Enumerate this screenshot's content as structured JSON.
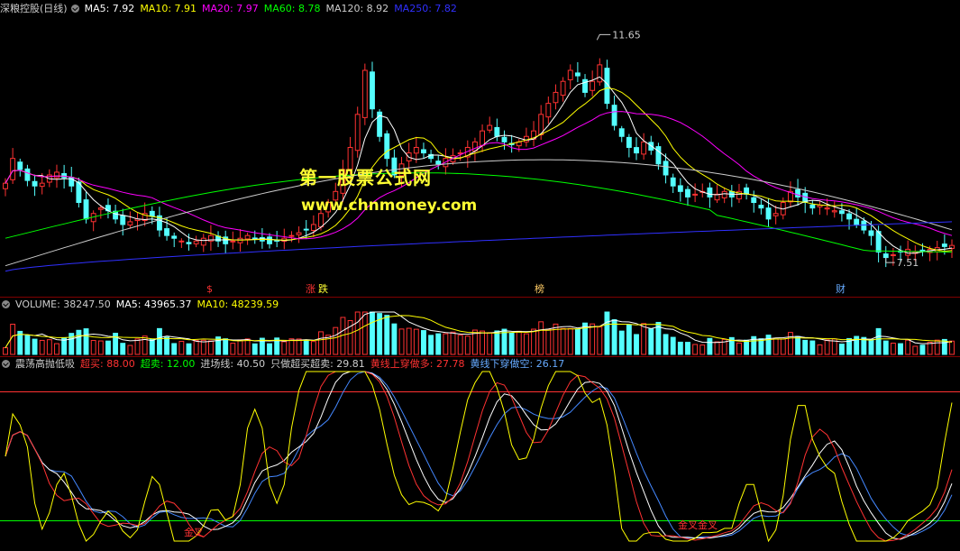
{
  "colors": {
    "up": "#ff3232",
    "down": "#54ffff",
    "ma5": "#ffffff",
    "ma10": "#ffff00",
    "ma20": "#ff00ff",
    "ma60": "#00ff00",
    "ma120": "#cccccc",
    "ma250": "#3030ff"
  },
  "main": {
    "title": "深粮控股(日线)",
    "ma5": "MA5: 7.92",
    "ma10": "MA10: 7.91",
    "ma20": "MA20: 7.97",
    "ma60": "MA60: 8.78",
    "ma120": "MA120: 8.92",
    "ma250": "MA250: 7.82",
    "high_label": "11.65",
    "low_label": "7.51",
    "watermark_cn": "第一股票公式网",
    "watermark_url": "www.chnmoney.com",
    "events": [
      {
        "text": "$",
        "color": "#ff3232"
      },
      {
        "text": "涨",
        "color": "#ff3232"
      },
      {
        "text": "跌",
        "color": "#ffff33"
      },
      {
        "text": "榜",
        "color": "#ffcc66"
      },
      {
        "text": "财",
        "color": "#66aaff"
      }
    ]
  },
  "volume": {
    "title": "VOLUME: 38247.50",
    "ma5": "MA5: 43965.37",
    "ma10": "MA10: 48239.59"
  },
  "indicator": {
    "title": "震荡高抛低吸",
    "p1": "超买: 88.00",
    "p2": "超卖: 12.00",
    "p3": "进场线: 40.50",
    "p4": "只做超买超卖: 29.81",
    "p5": "黄线上穿做多: 27.78",
    "p6": "黄线下穿做空: 26.17",
    "sig1": "金叉",
    "sig2": "金叉金叉"
  },
  "chart_data": {
    "type": "candlestick",
    "price_range": [
      7.51,
      11.65
    ],
    "close_series_approx": [
      8.95,
      9.4,
      9.2,
      9.0,
      8.9,
      8.95,
      9.1,
      9.15,
      9.05,
      8.9,
      8.6,
      8.3,
      8.4,
      8.5,
      8.45,
      8.3,
      8.2,
      8.25,
      8.3,
      8.4,
      8.35,
      8.1,
      8.0,
      7.95,
      7.9,
      7.85,
      7.9,
      7.95,
      8.0,
      7.9,
      7.85,
      7.9,
      7.95,
      8.0,
      7.95,
      7.9,
      7.85,
      7.9,
      7.95,
      8.0,
      8.05,
      8.1,
      8.2,
      8.4,
      8.6,
      8.8,
      9.2,
      9.6,
      10.2,
      11.0,
      10.3,
      9.8,
      9.4,
      9.1,
      9.3,
      9.5,
      9.6,
      9.5,
      9.4,
      9.3,
      9.4,
      9.45,
      9.5,
      9.6,
      9.7,
      9.9,
      10.0,
      9.8,
      9.7,
      9.65,
      9.7,
      9.8,
      9.9,
      10.2,
      10.4,
      10.6,
      10.8,
      11.0,
      10.9,
      10.6,
      10.8,
      11.1,
      10.4,
      10.0,
      9.8,
      9.6,
      9.5,
      9.7,
      9.55,
      9.3,
      9.1,
      8.9,
      8.8,
      8.7,
      8.75,
      8.8,
      8.7,
      8.75,
      8.8,
      8.7,
      8.8,
      8.75,
      8.6,
      8.5,
      8.3,
      8.4,
      8.6,
      8.8,
      8.7,
      8.6,
      8.5,
      8.55,
      8.5,
      8.45,
      8.4,
      8.3,
      8.2,
      8.1,
      8.0,
      7.7,
      7.6,
      7.65,
      7.7,
      7.75,
      7.7,
      7.72,
      7.75,
      7.78,
      7.8,
      7.82
    ],
    "volume_range": [
      0,
      120000
    ],
    "indicator_range": [
      0,
      100
    ],
    "indicator_levels": {
      "overbought": 88.0,
      "oversold": 12.0,
      "entry": 40.5
    }
  }
}
